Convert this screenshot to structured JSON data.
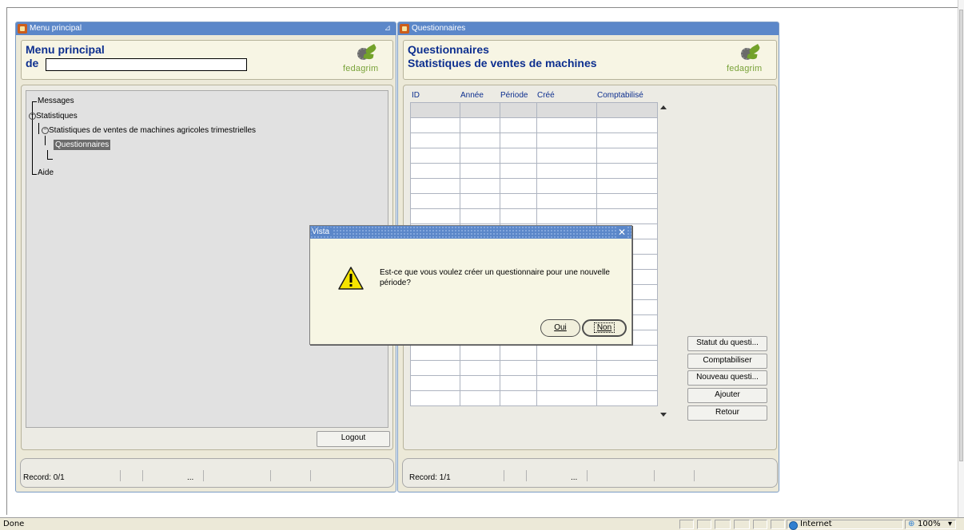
{
  "browser": {
    "status_text": "Done",
    "zone_label": "Internet",
    "zoom_label": "100%"
  },
  "left_window": {
    "title": "Menu principal",
    "header_title": "Menu principal",
    "header_subtitle_prefix": "de",
    "user_name_value": "",
    "logo_text": "fedagrim",
    "tree": [
      {
        "label": "Messages"
      },
      {
        "label": "Statistiques"
      },
      {
        "label": "Statistiques de ventes de machines agricoles trimestrielles"
      },
      {
        "label": "Questionnaires"
      },
      {
        "label": "Aide"
      }
    ],
    "logout_label": "Logout",
    "record_label": "Record: 0/1",
    "record_ellipsis": "..."
  },
  "right_window": {
    "title": "Questionnaires",
    "header_line1": "Questionnaires",
    "header_line2": "Statistiques de ventes de machines",
    "logo_text": "fedagrim",
    "columns": [
      "ID",
      "Année",
      "Période",
      "Créé",
      "Comptabilisé"
    ],
    "buttons": {
      "statut": "Statut du questi...",
      "comptabiliser": "Comptabiliser",
      "nouveau": "Nouveau questi...",
      "ajouter": "Ajouter",
      "retour": "Retour"
    },
    "record_label": "Record: 1/1",
    "record_ellipsis": "..."
  },
  "dialog": {
    "title": "Vista",
    "close_glyph": "✕",
    "message": "Est-ce que vous voulez créer un  questionnaire pour une nouvelle période?",
    "oui_label": "Oui",
    "non_label": "Non"
  },
  "icons": {
    "warning": "warning-icon",
    "close": "close-icon",
    "app": "app-icon"
  },
  "colors": {
    "titlebar": "#5b87c9",
    "header_text": "#0d2f8f",
    "panel_bg": "#ece9d8"
  }
}
